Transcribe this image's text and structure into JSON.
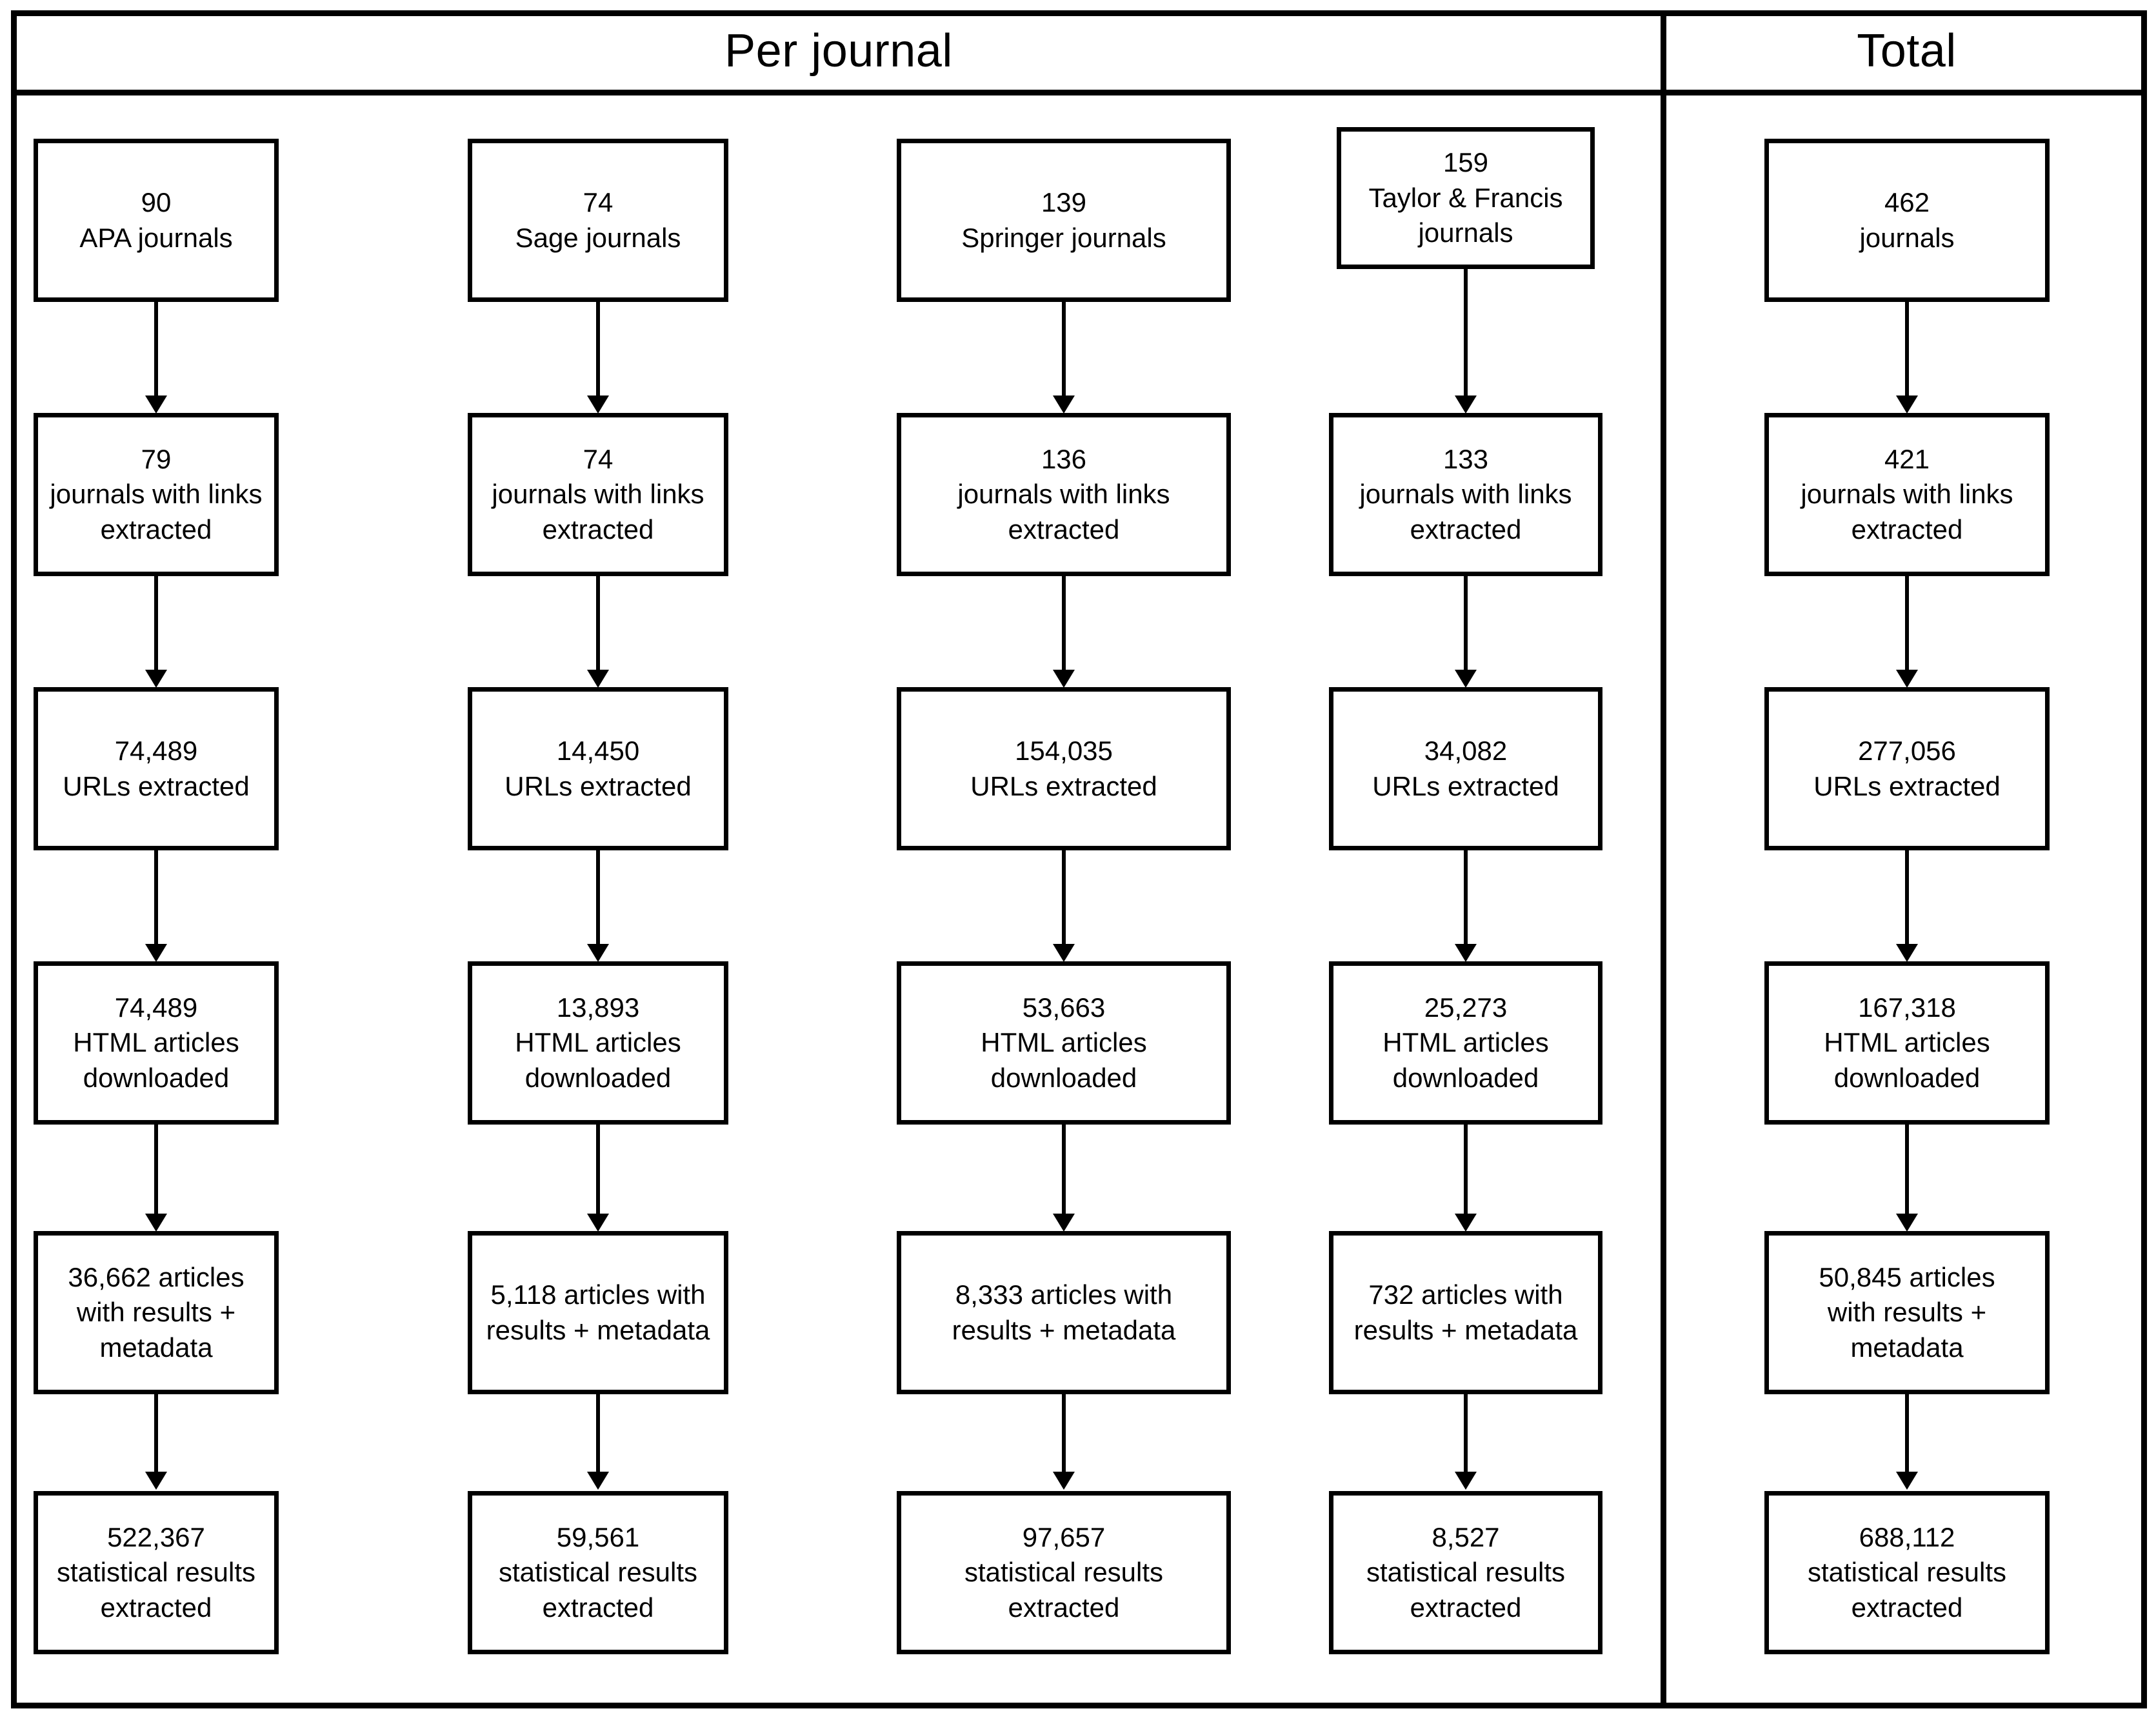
{
  "figure": {
    "headers": {
      "per_journal": "Per journal",
      "total": "Total"
    },
    "colors": {
      "stroke": "#000000",
      "background": "#ffffff",
      "text": "#000000"
    }
  },
  "columns": [
    {
      "key": "apa",
      "label": "APA journals"
    },
    {
      "key": "sage",
      "label": "Sage journals"
    },
    {
      "key": "springer",
      "label": "Springer journals"
    },
    {
      "key": "taylor_francis",
      "label": "Taylor & Francis journals"
    },
    {
      "key": "total",
      "label": "journals"
    }
  ],
  "stages": [
    {
      "key": "journals",
      "label": "journals"
    },
    {
      "key": "journals_with_links",
      "label": "journals with links extracted"
    },
    {
      "key": "urls_extracted",
      "label": "URLs extracted"
    },
    {
      "key": "html_downloaded",
      "label": "HTML articles downloaded"
    },
    {
      "key": "articles_results",
      "label": "articles with results + metadata"
    },
    {
      "key": "stat_results",
      "label": "statistical results extracted"
    }
  ],
  "boxes": {
    "r1": {
      "c1": {
        "value": "90",
        "lines": [
          "90",
          "APA journals"
        ]
      },
      "c2": {
        "value": "74",
        "lines": [
          "74",
          "Sage journals"
        ]
      },
      "c3": {
        "value": "139",
        "lines": [
          "139",
          "Springer journals"
        ]
      },
      "c4": {
        "value": "159",
        "lines": [
          "159",
          "Taylor & Francis",
          "journals"
        ]
      },
      "c5": {
        "value": "462",
        "lines": [
          "462",
          "journals"
        ]
      }
    },
    "r2": {
      "c1": {
        "value": "79",
        "lines": [
          "79",
          "journals with links",
          "extracted"
        ]
      },
      "c2": {
        "value": "74",
        "lines": [
          "74",
          "journals with links",
          "extracted"
        ]
      },
      "c3": {
        "value": "136",
        "lines": [
          "136",
          "journals with links",
          "extracted"
        ]
      },
      "c4": {
        "value": "133",
        "lines": [
          "133",
          "journals with links",
          "extracted"
        ]
      },
      "c5": {
        "value": "421",
        "lines": [
          "421",
          "journals with links",
          "extracted"
        ]
      }
    },
    "r3": {
      "c1": {
        "value": "74,489",
        "lines": [
          "74,489",
          "URLs extracted"
        ]
      },
      "c2": {
        "value": "14,450",
        "lines": [
          "14,450",
          "URLs extracted"
        ]
      },
      "c3": {
        "value": "154,035",
        "lines": [
          "154,035",
          "URLs extracted"
        ]
      },
      "c4": {
        "value": "34,082",
        "lines": [
          "34,082",
          "URLs extracted"
        ]
      },
      "c5": {
        "value": "277,056",
        "lines": [
          "277,056",
          "URLs extracted"
        ]
      }
    },
    "r4": {
      "c1": {
        "value": "74,489",
        "lines": [
          "74,489",
          "HTML articles",
          "downloaded"
        ]
      },
      "c2": {
        "value": "13,893",
        "lines": [
          "13,893",
          "HTML articles",
          "downloaded"
        ]
      },
      "c3": {
        "value": "53,663",
        "lines": [
          "53,663",
          "HTML articles",
          "downloaded"
        ]
      },
      "c4": {
        "value": "25,273",
        "lines": [
          "25,273",
          "HTML articles",
          "downloaded"
        ]
      },
      "c5": {
        "value": "167,318",
        "lines": [
          "167,318",
          "HTML articles",
          "downloaded"
        ]
      }
    },
    "r5": {
      "c1": {
        "value": "36,662",
        "lines": [
          "36,662 articles",
          "with results +",
          "metadata"
        ]
      },
      "c2": {
        "value": "5,118",
        "lines": [
          "5,118 articles with",
          "results + metadata"
        ]
      },
      "c3": {
        "value": "8,333",
        "lines": [
          "8,333 articles with",
          "results + metadata"
        ]
      },
      "c4": {
        "value": "732",
        "lines": [
          "732 articles with",
          "results + metadata"
        ]
      },
      "c5": {
        "value": "50,845",
        "lines": [
          "50,845 articles",
          "with results +",
          "metadata"
        ]
      }
    },
    "r6": {
      "c1": {
        "value": "522,367",
        "lines": [
          "522,367",
          "statistical results",
          "extracted"
        ]
      },
      "c2": {
        "value": "59,561",
        "lines": [
          "59,561",
          "statistical results",
          "extracted"
        ]
      },
      "c3": {
        "value": "97,657",
        "lines": [
          "97,657",
          "statistical results",
          "extracted"
        ]
      },
      "c4": {
        "value": "8,527",
        "lines": [
          "8,527",
          "statistical results",
          "extracted"
        ]
      },
      "c5": {
        "value": "688,112",
        "lines": [
          "688,112",
          "statistical results",
          "extracted"
        ]
      }
    }
  },
  "chart_data": {
    "type": "table",
    "title": "Per journal / Total article-extraction flow",
    "columns": [
      "APA journals",
      "Sage journals",
      "Springer journals",
      "Taylor & Francis journals",
      "Total"
    ],
    "rows": [
      {
        "stage": "journals",
        "values": [
          90,
          74,
          139,
          159,
          462
        ]
      },
      {
        "stage": "journals with links extracted",
        "values": [
          79,
          74,
          136,
          133,
          421
        ]
      },
      {
        "stage": "URLs extracted",
        "values": [
          74489,
          14450,
          154035,
          34082,
          277056
        ]
      },
      {
        "stage": "HTML articles downloaded",
        "values": [
          74489,
          13893,
          53663,
          25273,
          167318
        ]
      },
      {
        "stage": "articles with results + metadata",
        "values": [
          36662,
          5118,
          8333,
          732,
          50845
        ]
      },
      {
        "stage": "statistical results extracted",
        "values": [
          522367,
          59561,
          97657,
          8527,
          688112
        ]
      }
    ]
  }
}
